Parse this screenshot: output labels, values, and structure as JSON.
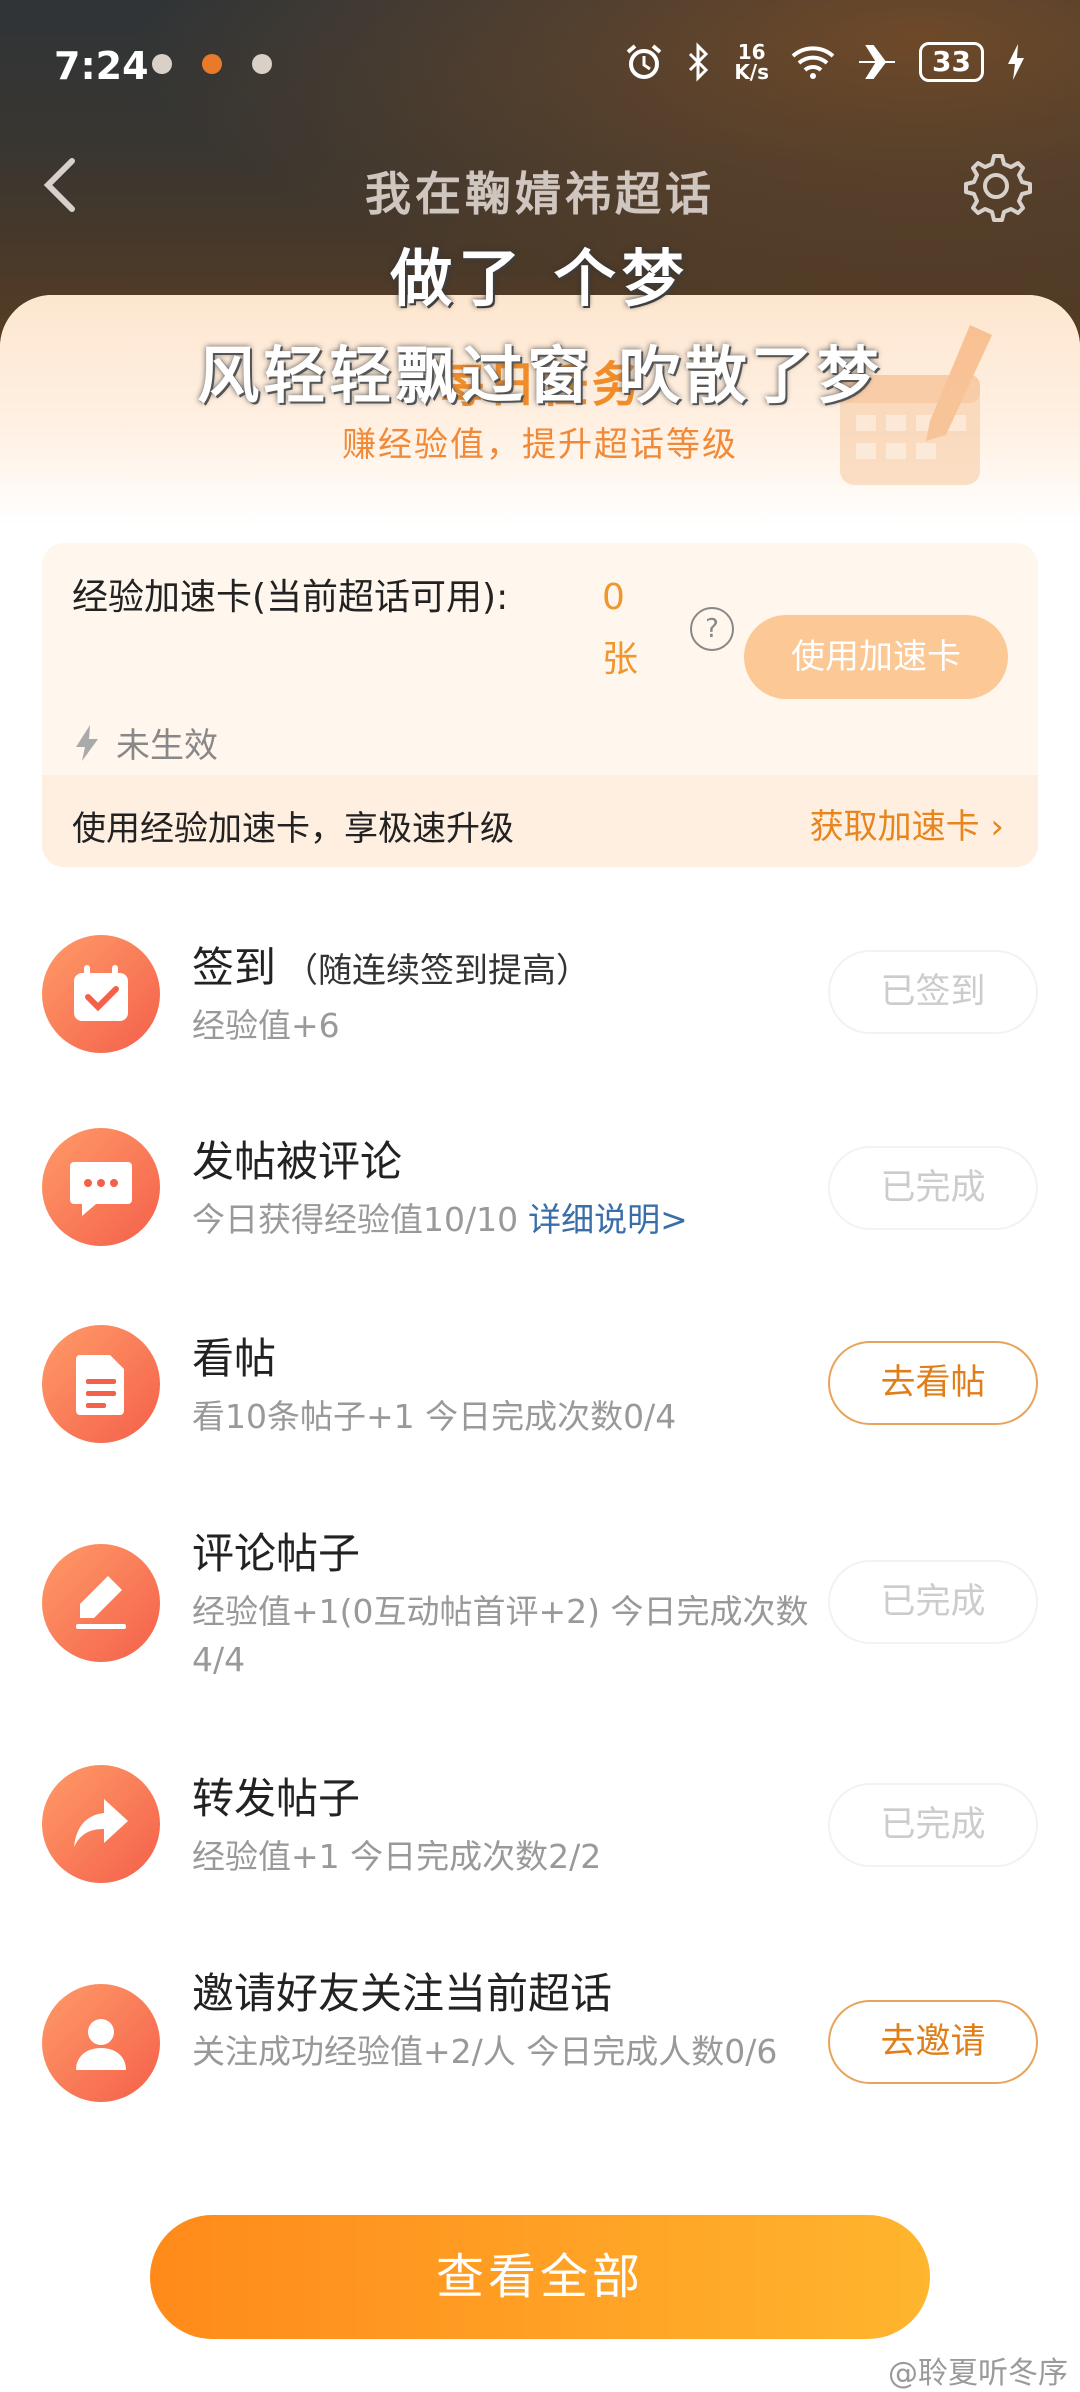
{
  "status_bar": {
    "time": "7:24",
    "net_speed_top": "16",
    "net_speed_bottom": "K/s",
    "battery": "33"
  },
  "header": {
    "title": "我在鞠婧祎超话"
  },
  "overlay_text": {
    "line1": "做了 个梦",
    "line2": "风轻轻飘过窗 吹散了梦"
  },
  "banner": {
    "title": "每日任务",
    "subtitle": "赚经验值，提升超话等级"
  },
  "accelerator": {
    "label": "经验加速卡(当前超话可用):",
    "count_value": "0",
    "count_unit": "张",
    "help": "?",
    "use_button": "使用加速卡",
    "state": "未生效",
    "promo": "使用经验加速卡，享极速升级",
    "get_link": "获取加速卡"
  },
  "tasks": [
    {
      "name": "签到",
      "note": "（随连续签到提高）",
      "desc": "经验值+6",
      "button": "已签到",
      "icon": "calendar-check-icon"
    },
    {
      "name": "发帖被评论",
      "note": "",
      "desc": "今日获得经验值10/10",
      "link": "详细说明>",
      "button": "已完成",
      "icon": "comment-bubble-icon"
    },
    {
      "name": "看帖",
      "note": "",
      "desc": "看10条帖子+1   今日完成次数0/4",
      "button": "去看帖",
      "icon": "document-icon"
    },
    {
      "name": "评论帖子",
      "note": "",
      "desc": "经验值+1(0互动帖首评+2)  今日完成次数4/4",
      "button": "已完成",
      "icon": "edit-pen-icon"
    },
    {
      "name": "转发帖子",
      "note": "",
      "desc": "经验值+1   今日完成次数2/2",
      "button": "已完成",
      "icon": "share-arrow-icon"
    },
    {
      "name": "邀请好友关注当前超话",
      "note": "",
      "desc": "关注成功经验值+2/人   今日完成人数0/6",
      "button": "去邀请",
      "icon": "user-icon"
    }
  ],
  "footer": {
    "view_all": "查看全部",
    "watermark": "@聆夏听冬序"
  },
  "colors": {
    "accent": "#f0962e",
    "button_gradient_start": "#ff8a1a",
    "button_gradient_end": "#ffb52e",
    "icon_gradient": "#f4604a"
  }
}
